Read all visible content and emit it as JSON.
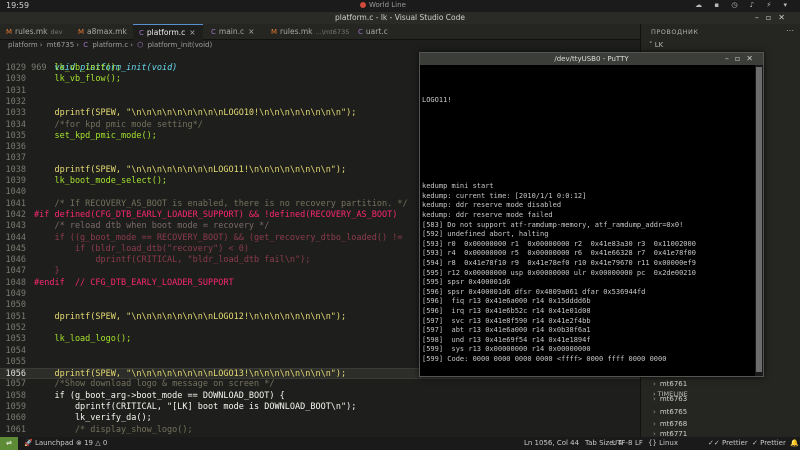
{
  "system": {
    "time": "19:59",
    "center_label": "World Line"
  },
  "window": {
    "title": "platform.c - lk - Visual Studio Code"
  },
  "tabs": [
    {
      "label": "rules.mk",
      "path": "dev"
    },
    {
      "label": "a8max.mk",
      "path": ""
    },
    {
      "label": "platform.c",
      "path": "...\\mt6735"
    },
    {
      "label": "main.c",
      "path": ""
    },
    {
      "label": "rules.mk",
      "path": "...\\mt6735"
    },
    {
      "label": "uart.c",
      "path": ""
    }
  ],
  "breadcrumb": [
    "platform",
    "mt6735",
    "platform.c",
    "platform_init(void)"
  ],
  "editor": {
    "header_line": {
      "num": "969",
      "text": "void platform_init(void)"
    },
    "lines": [
      {
        "num": "1029",
        "text": "    lk_vb_init();"
      },
      {
        "num": "1030",
        "text": "    lk_vb_flow();"
      },
      {
        "num": "1031",
        "text": ""
      },
      {
        "num": "1032",
        "text": ""
      },
      {
        "num": "1033",
        "text": "    dprintf(SPEW, \"\\n\\n\\n\\n\\n\\n\\n\\n\\nLOGO10!\\n\\n\\n\\n\\n\\n\\n\\n\");"
      },
      {
        "num": "1034",
        "text": "    /*for kpd pmic mode setting*/"
      },
      {
        "num": "1035",
        "text": "    set_kpd_pmic_mode();"
      },
      {
        "num": "1036",
        "text": ""
      },
      {
        "num": "1037",
        "text": ""
      },
      {
        "num": "1038",
        "text": "    dprintf(SPEW, \"\\n\\n\\n\\n\\n\\n\\n\\nLOGO11!\\n\\n\\n\\n\\n\\n\\n\\n\");"
      },
      {
        "num": "1039",
        "text": "    lk_boot_mode_select();"
      },
      {
        "num": "1040",
        "text": ""
      },
      {
        "num": "1041",
        "text": "    /* If RECOVERY_AS_BOOT is enabled, there is no recovery partition. */"
      },
      {
        "num": "1042",
        "text": "#if defined(CFG_DTB_EARLY_LOADER_SUPPORT) && !defined(RECOVERY_AS_BOOT)"
      },
      {
        "num": "1043",
        "text": "    /* reload dtb when boot mode = recovery */"
      },
      {
        "num": "1044",
        "text": "    if ((g_boot_mode == RECOVERY_BOOT) && (get_recovery_dtbo_loaded() !="
      },
      {
        "num": "1045",
        "text": "        if (bldr_load_dtb(\"recovery\") < 0)"
      },
      {
        "num": "1046",
        "text": "            dprintf(CRITICAL, \"bldr_load_dtb fail\\n\");"
      },
      {
        "num": "1047",
        "text": "    }"
      },
      {
        "num": "1048",
        "text": "#endif  // CFG_DTB_EARLY_LOADER_SUPPORT"
      },
      {
        "num": "1049",
        "text": ""
      },
      {
        "num": "1050",
        "text": ""
      },
      {
        "num": "1051",
        "text": "    dprintf(SPEW, \"\\n\\n\\n\\n\\n\\n\\n\\nLOGO12!\\n\\n\\n\\n\\n\\n\\n\\n\");"
      },
      {
        "num": "1052",
        "text": ""
      },
      {
        "num": "1053",
        "text": "    lk_load_logo();"
      },
      {
        "num": "1054",
        "text": ""
      },
      {
        "num": "1055",
        "text": ""
      },
      {
        "num": "1056",
        "text": "    dprintf(SPEW, \"\\n\\n\\n\\n\\n\\n\\n\\nLOGO13!\\n\\n\\n\\n\\n\\n\\n\\n\");"
      },
      {
        "num": "1057",
        "text": "    /*Show download logo & message on screen */"
      },
      {
        "num": "1058",
        "text": "    if (g_boot_arg->boot_mode == DOWNLOAD_BOOT) {"
      },
      {
        "num": "1059",
        "text": "        dprintf(CRITICAL, \"[LK] boot mode is DOWNLOAD_BOOT\\n\");"
      },
      {
        "num": "1060",
        "text": "        lk_verify_da();"
      },
      {
        "num": "1061",
        "text": "        /* display_show_logo();"
      }
    ]
  },
  "putty": {
    "title": "/dev/ttyUSB0 - PuTTY",
    "lines": [
      "",
      "",
      "",
      "LOGO11!",
      "",
      "",
      "",
      "",
      "",
      "",
      "",
      "",
      "kedump mini start",
      "kedump: current time: [2010/1/1 0:0:12]",
      "kedump: ddr reserve mode disabled",
      "kedump: ddr reserve mode failed",
      "[583] Do not support atf-ramdump-memory, atf_ramdump_addr=0x0!",
      "[592] undefined abort, halting",
      "[593] r0  0x00000000 r1  0x00000000 r2  0x41e83a30 r3  0x11002000",
      "[593] r4  0x00000000 r5  0x00000000 r6  0x41e66328 r7  0x41e78f00",
      "[594] r8  0x41e78f10 r9  0x41e78ef0 r10 0x41e79670 r11 0x00000ef9",
      "[595] r12 0x00000000 usp 0x00000000 ulr 0x00000000 pc  0x2de00210",
      "[595] spsr 0x400001d6",
      "[596] spsr 0x400001d6 dfsr 0x4809a061 dfar 0x536944fd",
      "[596]  fiq r13 0x41e6a000 r14 0x15dddd6b",
      "[596]  irq r13 0x41e6b52c r14 0x41e01d08",
      "[597]  svc r13 0x41e8f590 r14 0x41e2f4bb",
      "[597]  abt r13 0x41e6a000 r14 0x0b38f6a1",
      "[598]  und r13 0x41e69f54 r14 0x41e1894f",
      "[599]  sys r13 0x00000000 r14 0x00000000",
      "[599] Code: 0000 0000 0000 0000 <ffff> 0000 ffff 0000 0000"
    ]
  },
  "right_panel": {
    "header": "ПРОВОДНИК",
    "folder": "LK",
    "items": [
      "mt6761",
      "mt6763",
      "mt6765",
      "mt6768",
      "mt6771"
    ],
    "timeline": "TIMELINE"
  },
  "statusbar": {
    "launchpad": "Launchpad",
    "problems": "19",
    "warnings": "0",
    "position": "Ln 1056, Col 44",
    "tab_size": "Tab Size: 4",
    "encoding": "UTF-8",
    "eol": "LF",
    "language": "Linux",
    "prettier1": "Prettier",
    "prettier2": "Prettier"
  },
  "colors": {
    "putty_bg": "#000000",
    "editor_bg": "#1e1f1c",
    "accent_remote": "#5e8c36"
  }
}
